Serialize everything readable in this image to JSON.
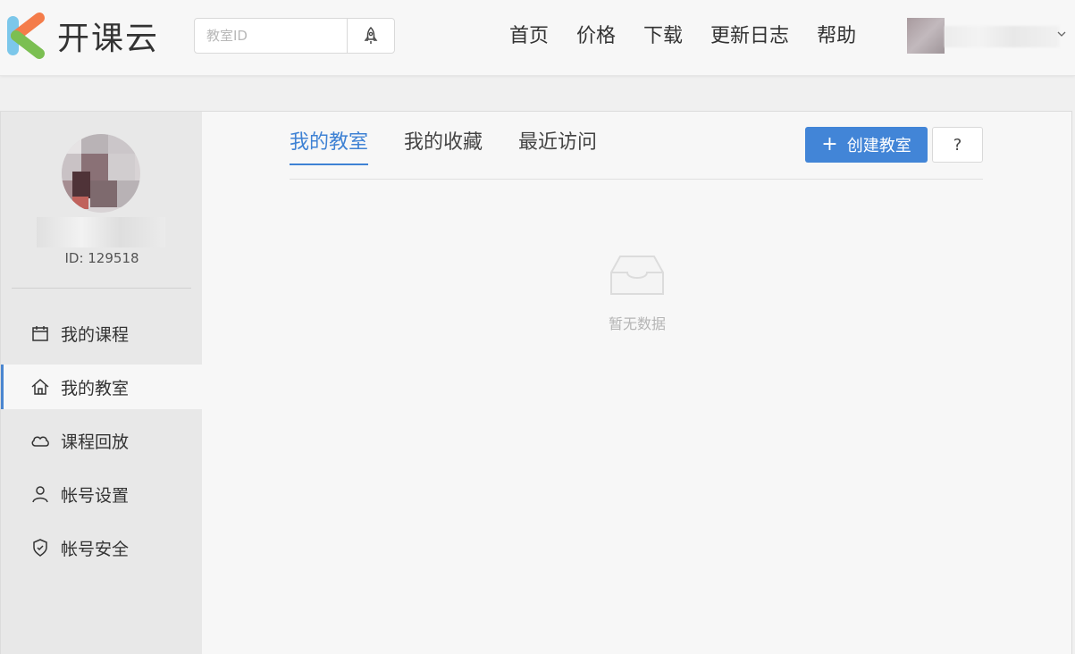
{
  "header": {
    "logo_text": "开课云",
    "search": {
      "placeholder": "教室ID",
      "value": ""
    },
    "nav": [
      "首页",
      "价格",
      "下载",
      "更新日志",
      "帮助"
    ]
  },
  "sidebar": {
    "profile_id": "ID: 129518",
    "items": [
      {
        "label": "我的课程",
        "icon": "calendar-icon",
        "active": false
      },
      {
        "label": "我的教室",
        "icon": "home-icon",
        "active": true
      },
      {
        "label": "课程回放",
        "icon": "cloud-icon",
        "active": false
      },
      {
        "label": "帐号设置",
        "icon": "user-icon",
        "active": false
      },
      {
        "label": "帐号安全",
        "icon": "shield-icon",
        "active": false
      }
    ]
  },
  "main": {
    "tabs": [
      {
        "label": "我的教室",
        "active": true
      },
      {
        "label": "我的收藏",
        "active": false
      },
      {
        "label": "最近访问",
        "active": false
      }
    ],
    "create_button": "创建教室",
    "help_button": "?",
    "empty_text": "暂无数据"
  },
  "colors": {
    "accent": "#4285d7",
    "tab_active": "#3f82d4",
    "header_bg": "#f7f7f7",
    "sidebar_bg": "#e8e8e8"
  }
}
